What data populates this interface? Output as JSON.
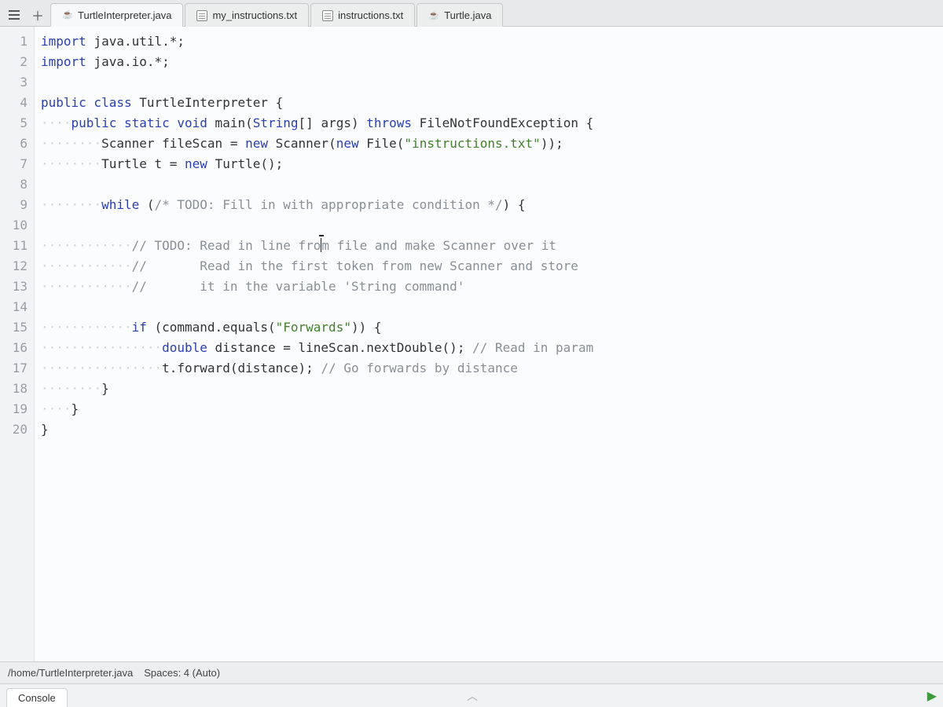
{
  "tabs": [
    {
      "label": "TurtleInterpreter.java",
      "type": "java",
      "active": true
    },
    {
      "label": "my_instructions.txt",
      "type": "txt",
      "active": false
    },
    {
      "label": "instructions.txt",
      "type": "txt",
      "active": false
    },
    {
      "label": "Turtle.java",
      "type": "java",
      "active": false
    }
  ],
  "code_lines": [
    {
      "n": 1,
      "indent": 0,
      "tokens": [
        [
          "kw",
          "import"
        ],
        [
          "pkg",
          " java.util.*"
        ],
        [
          "punc",
          ";"
        ]
      ]
    },
    {
      "n": 2,
      "indent": 0,
      "tokens": [
        [
          "kw",
          "import"
        ],
        [
          "pkg",
          " java.io.*"
        ],
        [
          "punc",
          ";"
        ]
      ]
    },
    {
      "n": 3,
      "indent": 0,
      "tokens": []
    },
    {
      "n": 4,
      "indent": 0,
      "tokens": [
        [
          "kw",
          "public class"
        ],
        [
          "id",
          " TurtleInterpreter "
        ],
        [
          "punc",
          "{"
        ]
      ]
    },
    {
      "n": 5,
      "indent": 4,
      "tokens": [
        [
          "kw",
          "public static void"
        ],
        [
          "id",
          " main"
        ],
        [
          "punc",
          "("
        ],
        [
          "typ",
          "String"
        ],
        [
          "punc",
          "[] "
        ],
        [
          "id",
          "args"
        ],
        [
          "punc",
          ") "
        ],
        [
          "kw",
          "throws"
        ],
        [
          "id",
          " FileNotFoundException "
        ],
        [
          "punc",
          "{"
        ]
      ]
    },
    {
      "n": 6,
      "indent": 8,
      "tokens": [
        [
          "id",
          "Scanner fileScan "
        ],
        [
          "punc",
          "= "
        ],
        [
          "kw",
          "new"
        ],
        [
          "id",
          " Scanner"
        ],
        [
          "punc",
          "("
        ],
        [
          "kw",
          "new"
        ],
        [
          "id",
          " File"
        ],
        [
          "punc",
          "("
        ],
        [
          "str",
          "\"instructions.txt\""
        ],
        [
          "punc",
          "));"
        ]
      ]
    },
    {
      "n": 7,
      "indent": 8,
      "tokens": [
        [
          "id",
          "Turtle t "
        ],
        [
          "punc",
          "= "
        ],
        [
          "kw",
          "new"
        ],
        [
          "id",
          " Turtle"
        ],
        [
          "punc",
          "();"
        ]
      ]
    },
    {
      "n": 8,
      "indent": 0,
      "tokens": []
    },
    {
      "n": 9,
      "indent": 8,
      "tokens": [
        [
          "kw",
          "while"
        ],
        [
          "punc",
          " ("
        ],
        [
          "cmt",
          "/* TODO: Fill in with appropriate condition */"
        ],
        [
          "punc",
          ") {"
        ]
      ]
    },
    {
      "n": 10,
      "indent": 0,
      "tokens": []
    },
    {
      "n": 11,
      "indent": 12,
      "caret_col": 25,
      "tokens": [
        [
          "cmt",
          "// TODO: Read in line from file and make Scanner over it"
        ]
      ]
    },
    {
      "n": 12,
      "indent": 12,
      "tokens": [
        [
          "cmt",
          "//       Read in the first token from new Scanner and store"
        ]
      ]
    },
    {
      "n": 13,
      "indent": 12,
      "tokens": [
        [
          "cmt",
          "//       it in the variable 'String command'"
        ]
      ]
    },
    {
      "n": 14,
      "indent": 0,
      "tokens": []
    },
    {
      "n": 15,
      "indent": 12,
      "tokens": [
        [
          "kw",
          "if"
        ],
        [
          "punc",
          " ("
        ],
        [
          "id",
          "command.equals"
        ],
        [
          "punc",
          "("
        ],
        [
          "str",
          "\"Forwards\""
        ],
        [
          "punc",
          ")) {"
        ]
      ]
    },
    {
      "n": 16,
      "indent": 16,
      "tokens": [
        [
          "kw",
          "double"
        ],
        [
          "id",
          " distance "
        ],
        [
          "punc",
          "= "
        ],
        [
          "id",
          "lineScan.nextDouble"
        ],
        [
          "punc",
          "(); "
        ],
        [
          "cmt",
          "// Read in param"
        ]
      ]
    },
    {
      "n": 17,
      "indent": 16,
      "tokens": [
        [
          "id",
          "t.forward"
        ],
        [
          "punc",
          "("
        ],
        [
          "id",
          "distance"
        ],
        [
          "punc",
          "); "
        ],
        [
          "cmt",
          "// Go forwards by distance"
        ]
      ]
    },
    {
      "n": 18,
      "indent": 8,
      "tokens": [
        [
          "punc",
          "}"
        ]
      ]
    },
    {
      "n": 19,
      "indent": 4,
      "tokens": [
        [
          "punc",
          "}"
        ]
      ]
    },
    {
      "n": 20,
      "indent": 0,
      "tokens": [
        [
          "punc",
          "}"
        ]
      ]
    }
  ],
  "status": {
    "path": "/home/TurtleInterpreter.java",
    "spaces": "Spaces: 4 (Auto)"
  },
  "console": {
    "tab_label": "Console"
  }
}
